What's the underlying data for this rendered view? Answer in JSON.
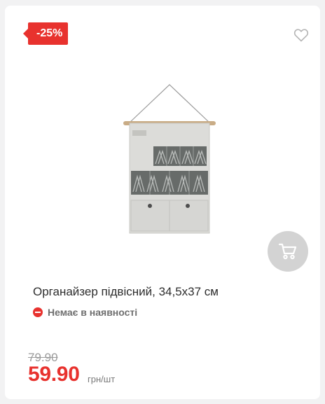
{
  "product": {
    "discount_badge": "-25%",
    "title": "Органайзер підвісний, 34,5х37 см",
    "availability": "Немає в наявності",
    "old_price": "79.90",
    "price": "59.90",
    "unit": "грн/шт"
  },
  "icons": {
    "favorite": "heart-outline-icon",
    "cart": "cart-icon",
    "availability": "minus-circle-icon"
  },
  "colors": {
    "accent": "#e8322e",
    "cart_button": "#d3d3d3"
  }
}
